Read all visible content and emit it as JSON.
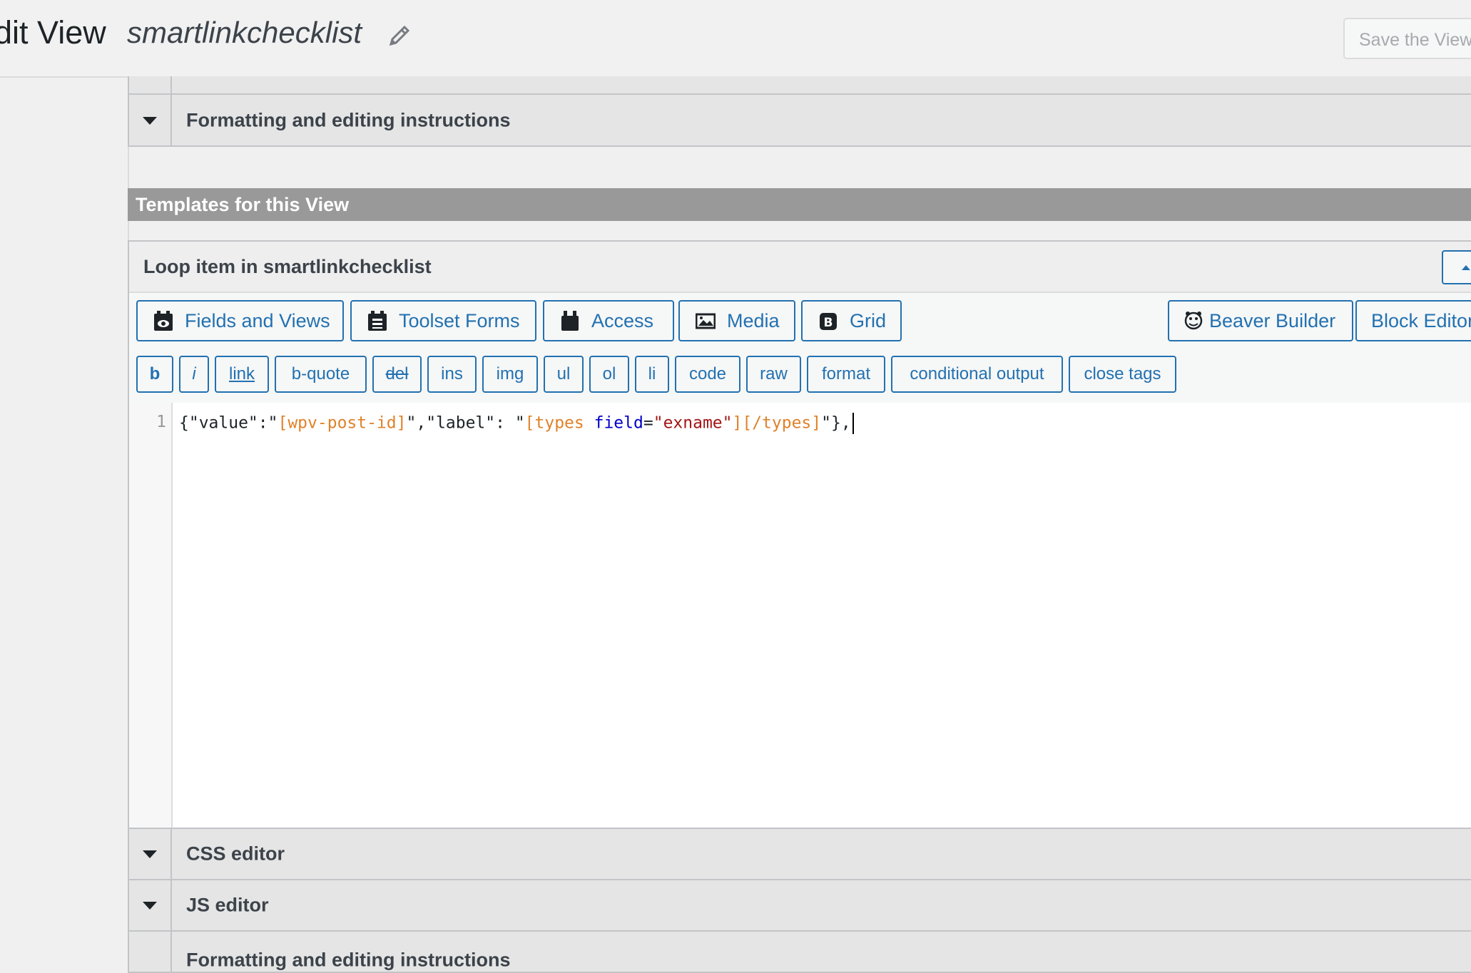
{
  "header": {
    "title": "dit View",
    "view_name": "smartlinkchecklist",
    "save_button": "Save the View"
  },
  "accordions": {
    "formatting": "Formatting and editing instructions",
    "css_editor": "CSS editor",
    "js_editor": "JS editor",
    "formatting_bottom": "Formatting and editing instructions"
  },
  "templates_section": {
    "title": "Templates for this View"
  },
  "loop_panel": {
    "title": "Loop item in smartlinkchecklist",
    "toolbar_buttons": [
      {
        "label": "Fields and Views",
        "icon": "eye-badge-icon"
      },
      {
        "label": "Toolset Forms",
        "icon": "forms-icon"
      },
      {
        "label": "Access",
        "icon": "lock-icon"
      },
      {
        "label": "Media",
        "icon": "image-icon"
      },
      {
        "label": "Grid",
        "icon": "bootstrap-icon"
      },
      {
        "label": "Beaver Builder",
        "icon": "beaver-icon"
      },
      {
        "label": "Block Editor",
        "icon": ""
      }
    ],
    "quicktags": [
      "b",
      "i",
      "link",
      "b-quote",
      "del",
      "ins",
      "img",
      "ul",
      "ol",
      "li",
      "code",
      "raw",
      "format",
      "conditional output",
      "close tags"
    ],
    "editor": {
      "line_number": "1",
      "code_parts": {
        "p1": "{\"value\":\"",
        "p2": "[wpv-post-id]",
        "p3": "\",\"label\": \"",
        "p4": "[types ",
        "p5": "field",
        "p6": "=",
        "p7": "\"exname\"",
        "p8": "][/types]",
        "p9": "\"},"
      }
    }
  },
  "colors": {
    "accent": "#2271b1",
    "section_header": "#999999",
    "shortcode": "#e0822a",
    "attribute": "#0000c8",
    "string": "#a31515"
  }
}
